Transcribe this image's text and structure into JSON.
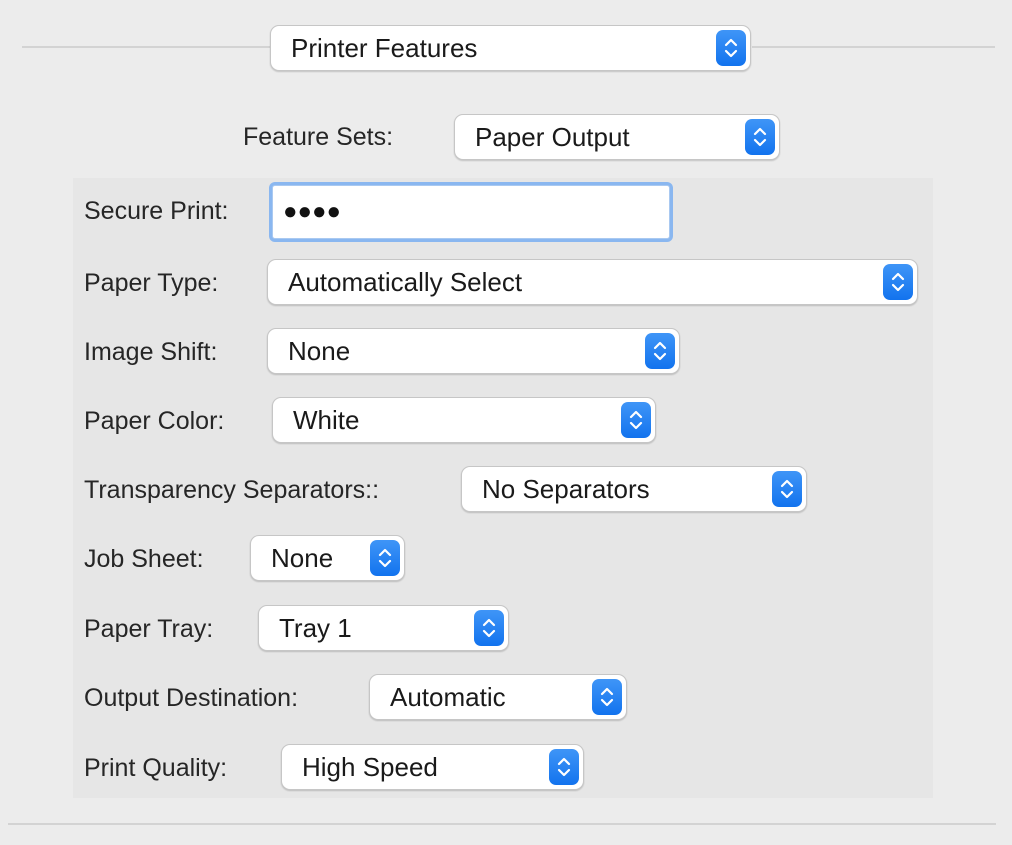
{
  "header": {
    "menu_value": "Printer Features"
  },
  "feature_sets": {
    "label": "Feature Sets:",
    "value": "Paper Output"
  },
  "secure_print": {
    "label": "Secure Print:",
    "value": "●●●●"
  },
  "settings": [
    {
      "label": "Paper Type:",
      "value": "Automatically Select"
    },
    {
      "label": "Image Shift:",
      "value": "None"
    },
    {
      "label": "Paper Color:",
      "value": "White"
    },
    {
      "label": "Transparency Separators::",
      "value": "No Separators"
    },
    {
      "label": "Job Sheet:",
      "value": "None"
    },
    {
      "label": "Paper Tray:",
      "value": "Tray 1"
    },
    {
      "label": "Output Destination:",
      "value": "Automatic"
    },
    {
      "label": "Print Quality:",
      "value": "High Speed"
    }
  ],
  "colors": {
    "window_background": "#ececec",
    "accent_blue": "#1a78f0",
    "focus_ring": "#8ab7f0"
  }
}
